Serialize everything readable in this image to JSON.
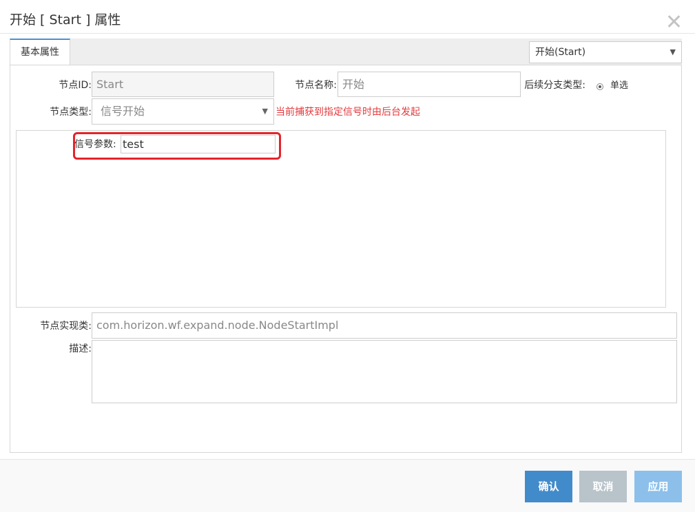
{
  "dialog": {
    "title": "开始 [ Start ] 属性"
  },
  "tabs": [
    {
      "label": "基本属性",
      "active": true
    }
  ],
  "node_selector": {
    "value": "开始(Start)"
  },
  "form": {
    "node_id": {
      "label": "节点ID:",
      "value": "Start"
    },
    "node_name": {
      "label": "节点名称:",
      "value": "开始"
    },
    "branch_type": {
      "label": "后续分支类型:",
      "option": "单选",
      "selected": true
    },
    "node_type": {
      "label": "节点类型:",
      "value": "信号开始",
      "hint": "当前捕获到指定信号时由后台发起"
    },
    "signal_param": {
      "label": "信号参数:",
      "value": "test"
    },
    "impl_class": {
      "label": "节点实现类:",
      "value": "com.horizon.wf.expand.node.NodeStartImpl"
    },
    "description": {
      "label": "描述:",
      "value": ""
    }
  },
  "buttons": {
    "confirm": "确认",
    "cancel": "取消",
    "apply": "应用"
  },
  "colors": {
    "primary": "#428bca",
    "disabled": "#b8c3ca",
    "apply": "#8cc0ea",
    "hint": "#e4393c",
    "highlight": "#e4232b"
  }
}
